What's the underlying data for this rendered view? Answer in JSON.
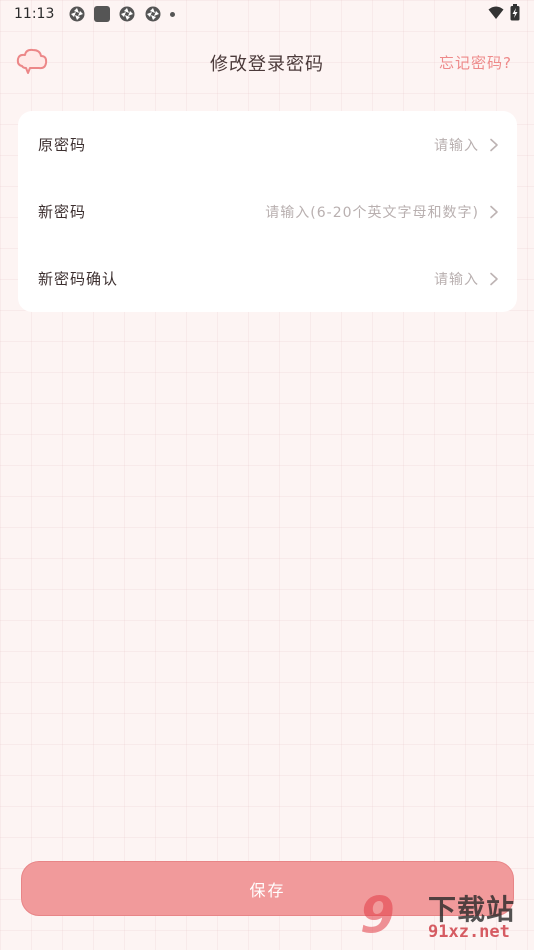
{
  "status_bar": {
    "time": "11:13"
  },
  "header": {
    "title": "修改登录密码",
    "forgot_link": "忘记密码?"
  },
  "form": {
    "rows": [
      {
        "label": "原密码",
        "placeholder": "请输入"
      },
      {
        "label": "新密码",
        "placeholder": "请输入(6-20个英文字母和数字)"
      },
      {
        "label": "新密码确认",
        "placeholder": "请输入"
      }
    ]
  },
  "save_label": "保存",
  "watermark": {
    "number": "9",
    "text": "下载站",
    "domain": "91xz.net"
  },
  "colors": {
    "accent": "#f19a9b",
    "link": "#ee8a8a",
    "background": "#fdf4f3"
  }
}
